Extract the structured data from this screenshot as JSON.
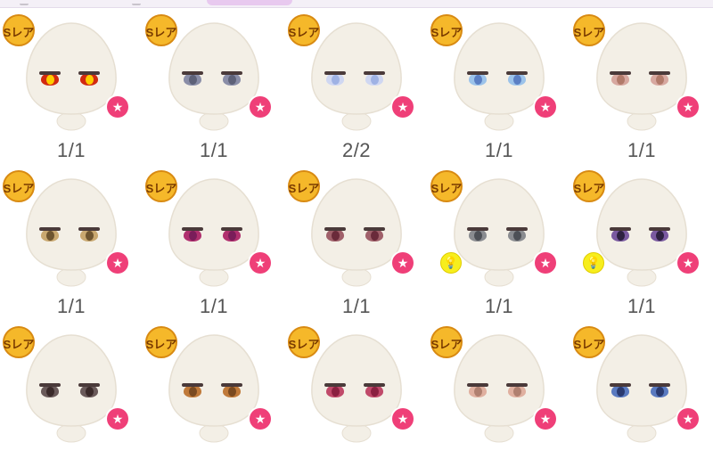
{
  "colors": {
    "star_button": "#ef3f78",
    "hint_button": "#f7ee1d",
    "badge_gold": "#f5b82a",
    "egg": "#f3efe6",
    "count_text": "#555555"
  },
  "badge_label": "Sレア",
  "items": [
    {
      "count": "1/1",
      "eye_color": "#d22a10",
      "iris_color": "#ffcc00",
      "hint": false
    },
    {
      "count": "1/1",
      "eye_color": "#8a8ea8",
      "iris_color": "#5d6178",
      "hint": false
    },
    {
      "count": "2/2",
      "eye_color": "#cfd7f2",
      "iris_color": "#9fb2e4",
      "hint": false
    },
    {
      "count": "1/1",
      "eye_color": "#9cc3ea",
      "iris_color": "#5b7fc4",
      "hint": false
    },
    {
      "count": "1/1",
      "eye_color": "#d7a8a0",
      "iris_color": "#b17a6a",
      "hint": false
    },
    {
      "count": "1/1",
      "eye_color": "#c9a870",
      "iris_color": "#6e5530",
      "hint": false
    },
    {
      "count": "1/1",
      "eye_color": "#b0306e",
      "iris_color": "#7a1d5a",
      "hint": false
    },
    {
      "count": "1/1",
      "eye_color": "#a0606a",
      "iris_color": "#6a2a3a",
      "hint": false
    },
    {
      "count": "1/1",
      "eye_color": "#8a8c90",
      "iris_color": "#4d5056",
      "hint": true
    },
    {
      "count": "1/1",
      "eye_color": "#7a5aa0",
      "iris_color": "#2d2140",
      "hint": true
    },
    {
      "count": "",
      "eye_color": "#6a5a5a",
      "iris_color": "#3a2a2a",
      "hint": false
    },
    {
      "count": "",
      "eye_color": "#c07a3a",
      "iris_color": "#7a4a20",
      "hint": false
    },
    {
      "count": "",
      "eye_color": "#c04a6a",
      "iris_color": "#8a2040",
      "hint": false
    },
    {
      "count": "",
      "eye_color": "#e0b0a0",
      "iris_color": "#b08070",
      "hint": false
    },
    {
      "count": "",
      "eye_color": "#5a7ac0",
      "iris_color": "#2a3a70",
      "hint": false
    }
  ]
}
